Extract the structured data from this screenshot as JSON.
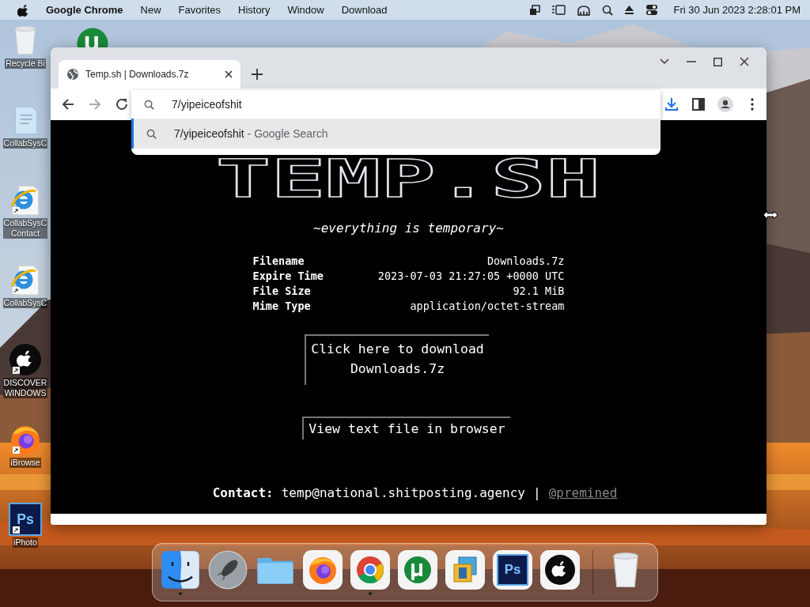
{
  "menu_bar": {
    "app_name": "Google Chrome",
    "menus": [
      "New",
      "Favorites",
      "History",
      "Window",
      "Download"
    ],
    "clock": "Fri 30 Jun 2023 2:28:01 PM"
  },
  "desktop_icons": [
    {
      "kind": "recycle",
      "label": "Recycle Bi"
    },
    {
      "kind": "document",
      "label": "CollabSysC"
    },
    {
      "kind": "web",
      "label": "CollabSysC\nContact"
    },
    {
      "kind": "web",
      "label": "CollabSysC"
    },
    {
      "kind": "apple",
      "label": "DISCOVER\nWINDOWS"
    },
    {
      "kind": "firefox",
      "label": "iBrowse"
    },
    {
      "kind": "photoshop",
      "label": "iPhoto",
      "badge": "Ps"
    }
  ],
  "browser": {
    "tabs": [
      {
        "title": "Temp.sh | Downloads.7z",
        "selected": true
      }
    ],
    "address": {
      "value": "7/yipeiceofshit"
    },
    "suggestions": [
      {
        "query": "7/yipeiceofshit",
        "source": "- Google Search",
        "selected": true
      }
    ],
    "page": {
      "logo": "TEMP.SH",
      "tagline": "~everything is temporary~",
      "details": [
        {
          "label": "Filename",
          "value": "Downloads.7z"
        },
        {
          "label": "Expire Time",
          "value": "2023-07-03 21:27:05 +0000 UTC"
        },
        {
          "label": "File Size",
          "value": "92.1 MiB"
        },
        {
          "label": "Mime Type",
          "value": "application/octet-stream"
        }
      ],
      "download_link": "Click here to download Downloads.7z",
      "view_link": "View text file in browser",
      "contact": {
        "label": "Contact:",
        "email": "temp@national.shitposting.agency",
        "separator": "|",
        "handle": "@premined"
      }
    }
  },
  "dock": [
    {
      "kind": "finder",
      "running": true
    },
    {
      "kind": "launchpad",
      "running": false
    },
    {
      "kind": "folder",
      "running": false
    },
    {
      "kind": "firefox",
      "running": false
    },
    {
      "kind": "chrome",
      "running": true
    },
    {
      "kind": "torrent",
      "running": false
    },
    {
      "kind": "squares",
      "running": false
    },
    {
      "kind": "photoshop",
      "running": false,
      "badge": "Ps"
    },
    {
      "kind": "apple",
      "running": false
    },
    {
      "kind": "trash",
      "running": false
    }
  ]
}
